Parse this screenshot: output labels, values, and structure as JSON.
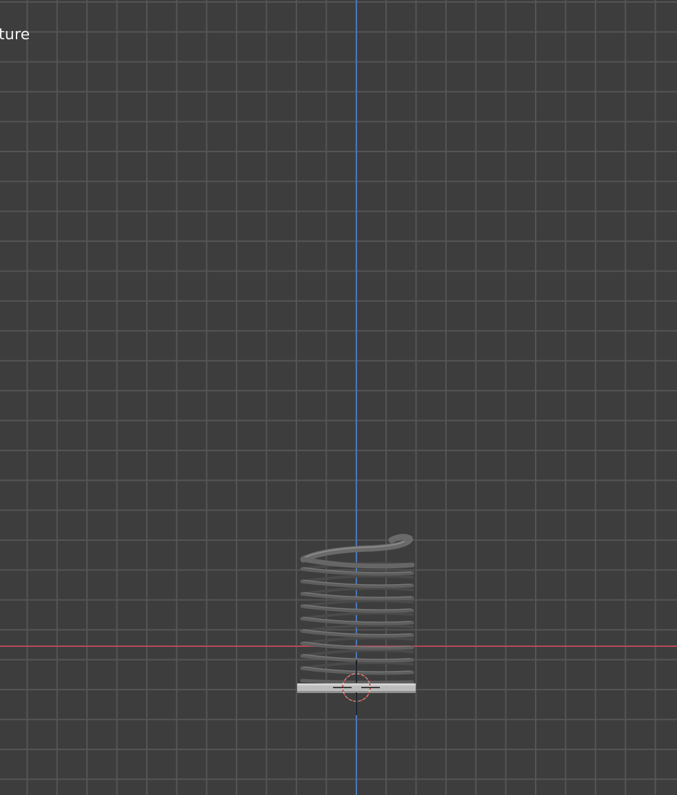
{
  "viewport": {
    "view_label": "ture",
    "colors": {
      "background": "#3d3d3d",
      "grid": "#555555",
      "x_axis": "#b84a58",
      "z_axis": "#4a78b8",
      "spring": "#5a5a5a",
      "base_plate": "#bdbdbd",
      "cursor_ring": "#c0392b"
    },
    "objects": [
      "spring",
      "base-plate",
      "3d-cursor"
    ]
  }
}
